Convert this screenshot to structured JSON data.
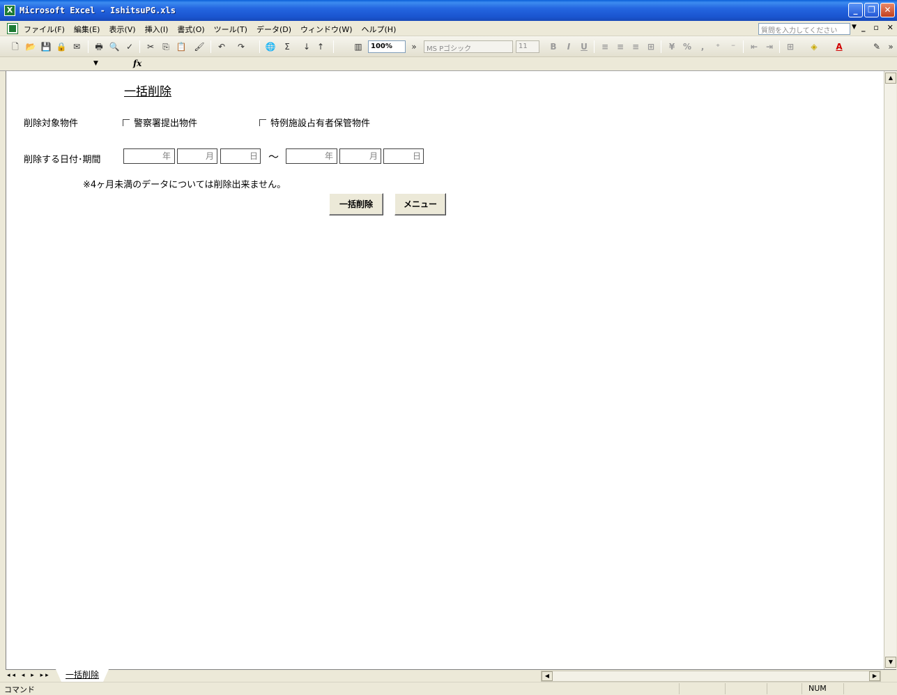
{
  "window": {
    "title": "Microsoft Excel - IshitsuPG.xls"
  },
  "menu": {
    "items": [
      "ファイル(F)",
      "編集(E)",
      "表示(V)",
      "挿入(I)",
      "書式(O)",
      "ツール(T)",
      "データ(D)",
      "ウィンドウ(W)",
      "ヘルプ(H)"
    ],
    "help_placeholder": "質問を入力してください"
  },
  "toolbar": {
    "zoom": "100%",
    "font": "MS Pゴシック",
    "font_size": "11"
  },
  "formula": {
    "fx": "fx"
  },
  "form": {
    "title": "一括削除",
    "target_label": "削除対象物件",
    "checkbox1_label": "警察署提出物件",
    "checkbox2_label": "特例施設占有者保管物件",
    "date_label": "削除する日付･期間",
    "unit_year": "年",
    "unit_month": "月",
    "unit_day": "日",
    "tilde": "～",
    "note": "※4ヶ月未満のデータについては削除出来ません。",
    "delete_button": "一括削除",
    "menu_button": "メニュー"
  },
  "sheet_tab": {
    "name": "一括削除"
  },
  "status": {
    "mode": "コマンド",
    "num": "NUM"
  }
}
